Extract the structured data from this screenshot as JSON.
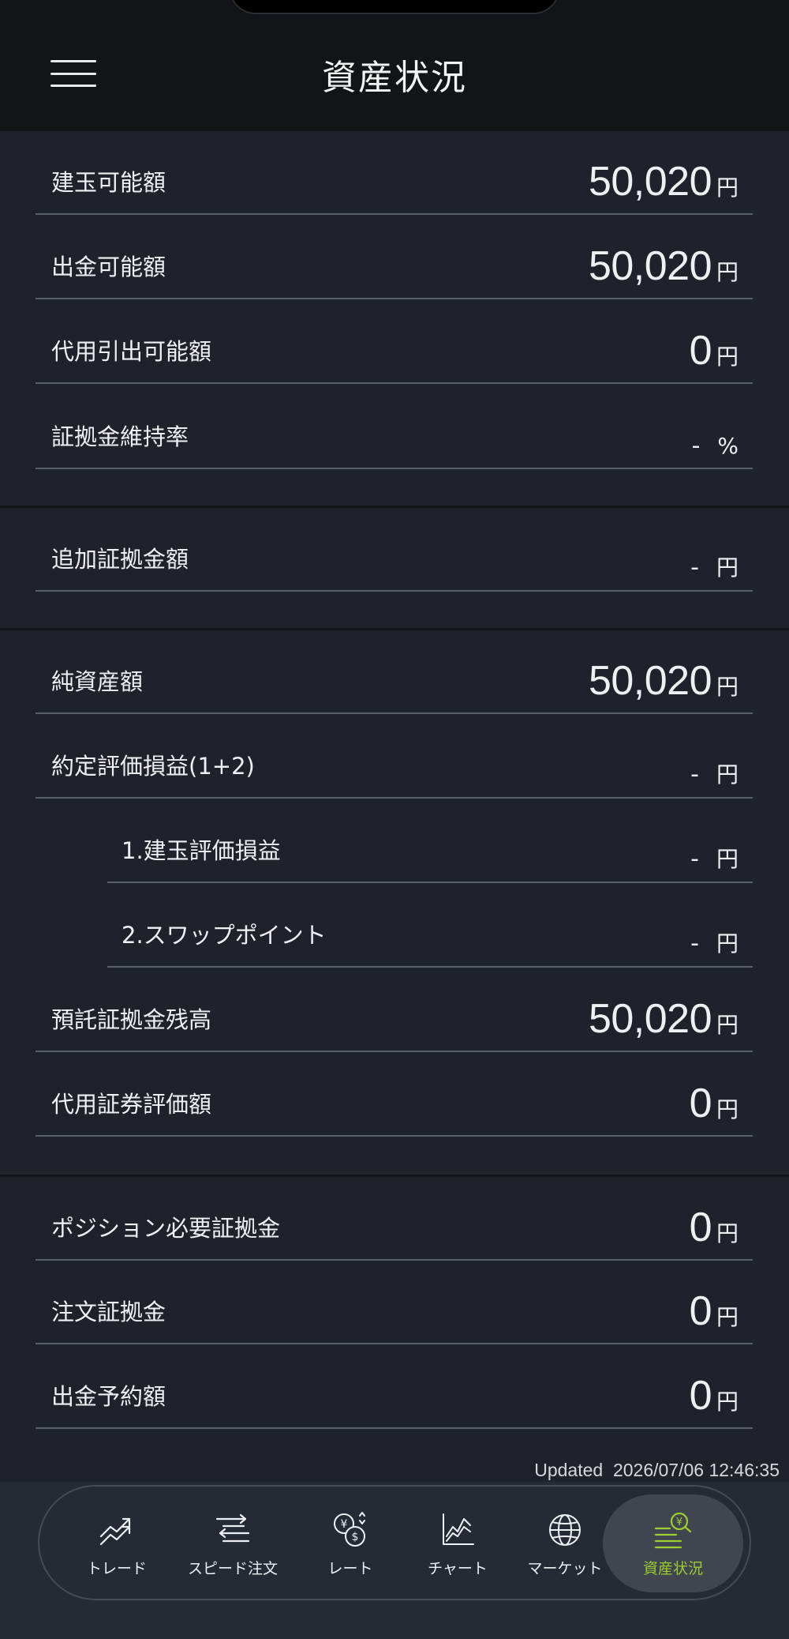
{
  "header": {
    "title": "資産状況",
    "menu_icon": "hamburger-menu-icon"
  },
  "rows": [
    {
      "label": "建玉可能額",
      "value": "50,020",
      "unit": "円"
    },
    {
      "label": "出金可能額",
      "value": "50,020",
      "unit": "円"
    },
    {
      "label": "代用引出可能額",
      "value": "0",
      "unit": "円"
    },
    {
      "label": "証拠金維持率",
      "value": "-",
      "unit": "%"
    },
    {
      "label": "追加証拠金額",
      "value": "-",
      "unit": "円"
    },
    {
      "label": "純資産額",
      "value": "50,020",
      "unit": "円"
    },
    {
      "label": "約定評価損益(1+2)",
      "value": "-",
      "unit": "円"
    },
    {
      "label": "1.建玉評価損益",
      "value": "-",
      "unit": "円"
    },
    {
      "label": "2.スワップポイント",
      "value": "-",
      "unit": "円"
    },
    {
      "label": "預託証拠金残高",
      "value": "50,020",
      "unit": "円"
    },
    {
      "label": "代用証券評価額",
      "value": "0",
      "unit": "円"
    },
    {
      "label": "ポジション必要証拠金",
      "value": "0",
      "unit": "円"
    },
    {
      "label": "注文証拠金",
      "value": "0",
      "unit": "円"
    },
    {
      "label": "出金予約額",
      "value": "0",
      "unit": "円"
    }
  ],
  "updated": {
    "label": "Updated",
    "timestamp": "2026/07/06 12:46:35"
  },
  "tabs": [
    {
      "label": "トレード",
      "icon": "trend-arrows-icon"
    },
    {
      "label": "スピード注文",
      "icon": "speed-order-icon"
    },
    {
      "label": "レート",
      "icon": "currency-rate-icon"
    },
    {
      "label": "チャート",
      "icon": "chart-icon"
    },
    {
      "label": "マーケット",
      "icon": "globe-icon"
    },
    {
      "label": "資産状況",
      "icon": "assets-icon",
      "active": true
    }
  ],
  "colors": {
    "background": "#1f222a",
    "header": "#121418",
    "accent": "#9acd32",
    "divider": "#5a5e66"
  }
}
